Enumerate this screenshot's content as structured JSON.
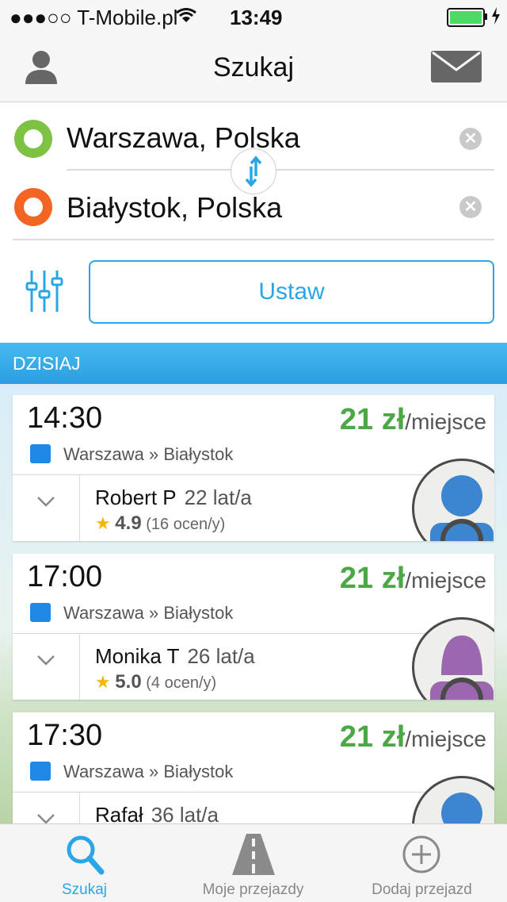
{
  "status_bar": {
    "carrier": "●●●○○ T-Mobile.pl",
    "time": "13:49"
  },
  "nav": {
    "title": "Szukaj",
    "left_icon": "person-icon",
    "right_icon": "mail-icon"
  },
  "search": {
    "from": {
      "value": "Warszawa, Polska",
      "color": "#7dc242"
    },
    "to": {
      "value": "Białystok, Polska",
      "color": "#f26522"
    },
    "set_button": "Ustaw"
  },
  "section_header": "DZISIAJ",
  "rides": [
    {
      "time": "14:30",
      "price": "21 zł",
      "unit": "/miejsce",
      "route": "Warszawa » Białystok",
      "driver": "Robert P",
      "age": "22 lat/a",
      "rating": "4.9",
      "reviews": "(16 ocen/y)",
      "avatar_color": "#3d86cf"
    },
    {
      "time": "17:00",
      "price": "21 zł",
      "unit": "/miejsce",
      "route": "Warszawa » Białystok",
      "driver": "Monika T",
      "age": "26 lat/a",
      "rating": "5.0",
      "reviews": "(4 ocen/y)",
      "avatar_color": "#9b68b0"
    },
    {
      "time": "17:30",
      "price": "21 zł",
      "unit": "/miejsce",
      "route": "Warszawa » Białystok",
      "driver": "Rafał",
      "age": "36 lat/a",
      "rating": "",
      "reviews": "",
      "avatar_color": "#3d86cf"
    }
  ],
  "tabs": [
    {
      "label": "Szukaj",
      "icon": "search-icon",
      "active": true
    },
    {
      "label": "Moje przejazdy",
      "icon": "road-icon",
      "active": false
    },
    {
      "label": "Dodaj przejazd",
      "icon": "add-circle-icon",
      "active": false
    }
  ],
  "colors": {
    "accent": "#2aa6e8",
    "price": "#4ca844",
    "star": "#f5b800"
  }
}
